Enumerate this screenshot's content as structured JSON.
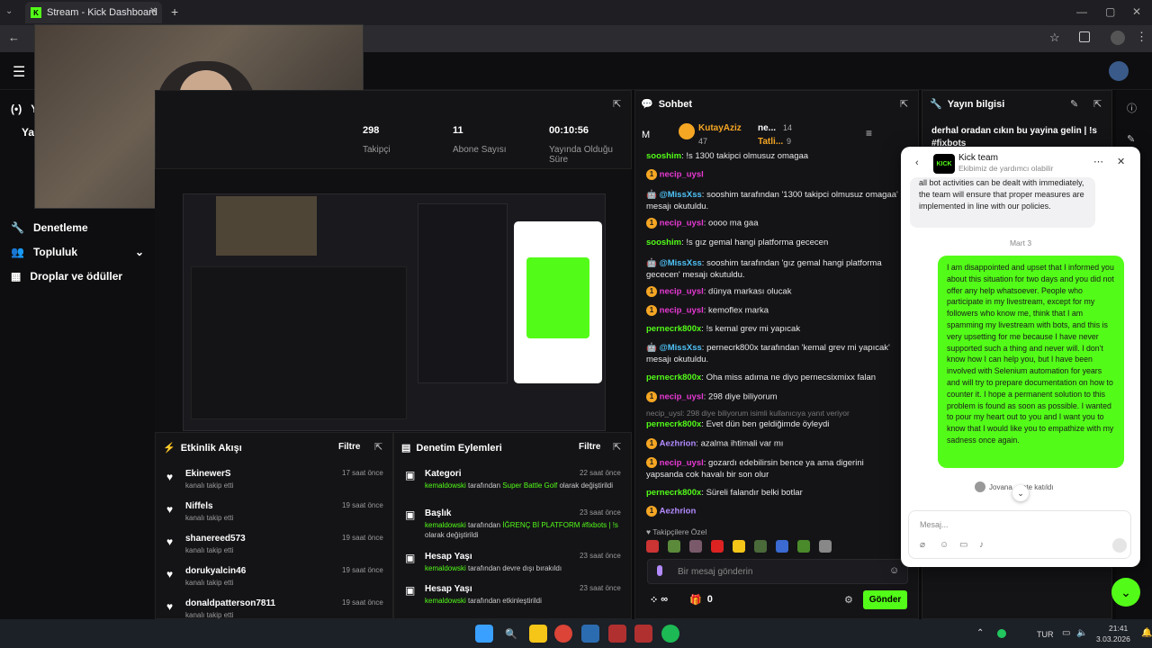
{
  "browser": {
    "tab_title": "Stream - Kick Dashboard",
    "new_tab": "+"
  },
  "sidebar": {
    "items": [
      {
        "label": "Denetleme"
      },
      {
        "label": "Topluluk"
      },
      {
        "label": "Droplar ve ödüller"
      }
    ],
    "partial": [
      "Ya",
      "Ya"
    ]
  },
  "stats": [
    {
      "value": "298",
      "label": "Takipçi"
    },
    {
      "value": "11",
      "label": "Abone Sayısı"
    },
    {
      "value": "00:10:56",
      "label": "Yayında Olduğu Süre"
    }
  ],
  "chat": {
    "title": "Sohbet",
    "top_user": "KutayAziz",
    "top_count": "47",
    "other1": "ne...",
    "other1_count": "14",
    "other2": "Tatli...",
    "other2_count": "9",
    "mod_letter": "M",
    "lines": [
      {
        "user": "sooshim",
        "text": "!s 1300 takipci olmusuz omagaa",
        "cls": "u1"
      },
      {
        "user": "necip_uysl",
        "text": "",
        "cls": "u2"
      },
      {
        "user": "@MissXss",
        "text": "sooshim tarafından '1300 takipci olmusuz omagaa' mesajı okutuldu.",
        "cls": "u3"
      },
      {
        "user": "necip_uysl",
        "text": "oooo ma gaa",
        "cls": "u2"
      },
      {
        "user": "sooshim",
        "text": "!s gız gemal hangi platforma gececen",
        "cls": "u1"
      },
      {
        "user": "@MissXss",
        "text": "sooshim tarafından 'gız gemal hangi platforma gececen' mesajı okutuldu.",
        "cls": "u3"
      },
      {
        "user": "necip_uysl",
        "text": "dünya markası olucak",
        "cls": "u2"
      },
      {
        "user": "necip_uysl",
        "text": "kemoflex marka",
        "cls": "u2"
      },
      {
        "user": "pernecrk800x",
        "text": "!s kemal grev mi yapıcak",
        "cls": "u1"
      },
      {
        "user": "@MissXss",
        "text": "pernecrk800x tarafından 'kemal grev mi yapıcak' mesajı okutuldu.",
        "cls": "u3"
      },
      {
        "user": "pernecrk800x",
        "text": "Oha miss adıma ne diyo pernecsixmixx falan",
        "cls": "u1"
      },
      {
        "user": "necip_uysl",
        "text": "298 diye biliyorum",
        "cls": "u2"
      },
      {
        "user": "pernecrk800x",
        "text": "Evet dün ben geldiğimde öyleydi",
        "cls": "u1"
      },
      {
        "user": "Aezhrion",
        "text": "azalma ihtimali var mı",
        "cls": "u4"
      },
      {
        "user": "necip_uysl",
        "text": "gozardı edebilirsin bence ya ama digerini yapsanda cok havalı bir son olur",
        "cls": "u2"
      },
      {
        "user": "pernecrk800x",
        "text": "Süreli falandır belki botlar",
        "cls": "u1"
      },
      {
        "user": "Aezhrion",
        "text": "",
        "cls": "u4"
      }
    ],
    "reply_hint": "necip_uysl: 298 diye biliyorum isimli kullanıcıya yanıt veriyor",
    "followers_only": "Takipçilere Özel",
    "placeholder": "Bir mesaj gönderin",
    "infinity": "∞",
    "gift_count": "0",
    "send": "Gönder"
  },
  "stream_info": {
    "title": "Yayın bilgisi",
    "stream_title": "derhal oradan cıkın bu yayina gelin | !s #fixbots"
  },
  "activity": {
    "title": "Etkinlik Akışı",
    "filter": "Filtre",
    "items": [
      {
        "name": "EkinewerS",
        "sub": "kanalı takip etti",
        "time": "17 saat önce"
      },
      {
        "name": "Niffels",
        "sub": "kanalı takip etti",
        "time": "19 saat önce"
      },
      {
        "name": "shanereed573",
        "sub": "kanalı takip etti",
        "time": "19 saat önce"
      },
      {
        "name": "dorukyalcin46",
        "sub": "kanalı takip etti",
        "time": "19 saat önce"
      },
      {
        "name": "donaldpatterson7811",
        "sub": "kanalı takip etti",
        "time": "19 saat önce"
      }
    ]
  },
  "moderation": {
    "title": "Denetim Eylemleri",
    "filter": "Filtre",
    "items": [
      {
        "name": "Kategori",
        "user": "kemaldowski",
        "mid": "tarafından",
        "hl": "Super Battle Golf",
        "end": "olarak değiştirildi",
        "time": "22 saat önce"
      },
      {
        "name": "Başlık",
        "user": "kemaldowski",
        "mid": "tarafından",
        "hl": "İĞRENÇ Bİ PLATFORM #fixbots | !s",
        "end": "olarak değiştirildi",
        "time": "23 saat önce"
      },
      {
        "name": "Hesap Yaşı",
        "user": "kemaldowski",
        "mid": "tarafından devre dışı bırakıldı",
        "hl": "",
        "end": "",
        "time": "23 saat önce"
      },
      {
        "name": "Hesap Yaşı",
        "user": "kemaldowski",
        "mid": "tarafından etkinleştirildi",
        "hl": "",
        "end": "",
        "time": "23 saat önce"
      }
    ]
  },
  "support": {
    "name": "Kick team",
    "subtitle": "Ekibimiz de yardımcı olabilir",
    "logo": "KICK",
    "prev_msg": "all bot activities can be dealt with immediately, the team will ensure that proper measures are implemented in line with our policies.",
    "date": "Mart 3",
    "user_msg": "I am disappointed and upset that I informed you about this situation for two days and you did not offer any help whatsoever. People who participate in my livestream, except for my followers who know me, think that I am spamming my livestream with bots, and this is very upsetting for me because I have never supported such a thing and never will. I don't know how I can help you, but I have been involved with Selenium automation for years and will try to prepare documentation on how to counter it. I hope a permanent solution to this problem is found as soon as possible. I wanted to pour my heart out to you and I want you to know that I would like you to empathize with my sadness once again.",
    "joined": "Jovana ... ete katıldı",
    "placeholder": "Mesaj..."
  },
  "taskbar": {
    "lang": "TUR",
    "time": "21:41",
    "date": "3.03.2026"
  },
  "colors": {
    "accent": "#53fc18",
    "bg": "#0b0b0d",
    "panel": "#141417"
  }
}
